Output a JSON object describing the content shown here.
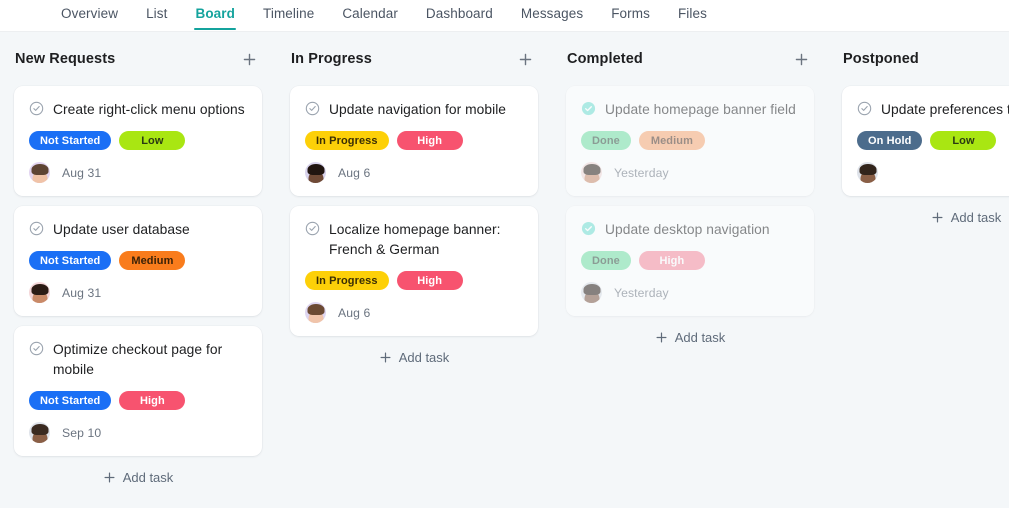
{
  "nav": {
    "tabs": [
      {
        "label": "Overview",
        "active": false
      },
      {
        "label": "List",
        "active": false
      },
      {
        "label": "Board",
        "active": true
      },
      {
        "label": "Timeline",
        "active": false
      },
      {
        "label": "Calendar",
        "active": false
      },
      {
        "label": "Dashboard",
        "active": false
      },
      {
        "label": "Messages",
        "active": false
      },
      {
        "label": "Forms",
        "active": false
      },
      {
        "label": "Files",
        "active": false
      }
    ],
    "active_color": "#14a39d"
  },
  "board": {
    "add_task_label": "Add task",
    "add_column_icon": "plus-icon",
    "columns": [
      {
        "title": "New Requests",
        "show_header_add": true,
        "show_add_task": true,
        "muted": false,
        "cards": [
          {
            "title": "Create right-click menu options",
            "status": {
              "label": "Not Started",
              "bg": "#1a6ff5",
              "fg": "#ffffff"
            },
            "priority": {
              "label": "Low",
              "bg": "#a9e612",
              "fg": "#2b3a12"
            },
            "due": "Aug 31",
            "avatar": {
              "hair": "#5e4433",
              "skin": "#f0c3a8",
              "ring": "#e2d4f0"
            },
            "done": false
          },
          {
            "title": "Update user database",
            "status": {
              "label": "Not Started",
              "bg": "#1a6ff5",
              "fg": "#ffffff"
            },
            "priority": {
              "label": "Medium",
              "bg": "#f97c1c",
              "fg": "#3b2207"
            },
            "due": "Aug 31",
            "avatar": {
              "hair": "#2b1b14",
              "skin": "#c98a68",
              "ring": "#f4d6d8"
            },
            "done": false
          },
          {
            "title": "Optimize checkout page for mobile",
            "status": {
              "label": "Not Started",
              "bg": "#1a6ff5",
              "fg": "#ffffff"
            },
            "priority": {
              "label": "High",
              "bg": "#f7536f",
              "fg": "#ffffff"
            },
            "due": "Sep 10",
            "avatar": {
              "hair": "#3a2a20",
              "skin": "#8a5f46",
              "ring": "#dfe3ea"
            },
            "done": false
          }
        ]
      },
      {
        "title": "In Progress",
        "show_header_add": true,
        "show_add_task": true,
        "muted": false,
        "cards": [
          {
            "title": "Update navigation for mobile",
            "status": {
              "label": "In Progress",
              "bg": "#fdd008",
              "fg": "#3b2f05"
            },
            "priority": {
              "label": "High",
              "bg": "#f7536f",
              "fg": "#ffffff"
            },
            "due": "Aug 6",
            "avatar": {
              "hair": "#201510",
              "skin": "#6f4a36",
              "ring": "#d8d3ec"
            },
            "done": false
          },
          {
            "title": "Localize homepage banner: French & German",
            "status": {
              "label": "In Progress",
              "bg": "#fdd008",
              "fg": "#3b2f05"
            },
            "priority": {
              "label": "High",
              "bg": "#f7536f",
              "fg": "#ffffff"
            },
            "due": "Aug 6",
            "avatar": {
              "hair": "#6b4a33",
              "skin": "#f0c4aa",
              "ring": "#ded6f1"
            },
            "done": false
          }
        ]
      },
      {
        "title": "Completed",
        "show_header_add": true,
        "show_add_task": true,
        "muted": true,
        "cards": [
          {
            "title": "Update homepage banner field",
            "status": {
              "label": "Done",
              "bg": "#6fe0a3",
              "fg": "#2d4a3a"
            },
            "priority": {
              "label": "Medium",
              "bg": "#f8a571",
              "fg": "#4a3020"
            },
            "due": "Yesterday",
            "avatar": {
              "hair": "#241810",
              "skin": "#c98a68",
              "ring": "#f2d8d6"
            },
            "done": true
          },
          {
            "title": "Update desktop navigation",
            "status": {
              "label": "Done",
              "bg": "#6fe0a3",
              "fg": "#2d4a3a"
            },
            "priority": {
              "label": "High",
              "bg": "#f7879b",
              "fg": "#ffffff"
            },
            "due": "Yesterday",
            "avatar": {
              "hair": "#221711",
              "skin": "#7a5340",
              "ring": "#d9dde4"
            },
            "done": true
          }
        ]
      },
      {
        "title": "Postponed",
        "show_header_add": false,
        "show_add_task": true,
        "muted": false,
        "cards": [
          {
            "title": "Update preferences tab",
            "status": {
              "label": "On Hold",
              "bg": "#4c6c8c",
              "fg": "#ffffff"
            },
            "priority": {
              "label": "Low",
              "bg": "#a9e612",
              "fg": "#2b3a12"
            },
            "due": "",
            "avatar": {
              "hair": "#32241b",
              "skin": "#8a5f46",
              "ring": "#dee2e9"
            },
            "done": false
          }
        ]
      }
    ]
  },
  "theme": {
    "page_bg": "#f4f7f9",
    "card_bg": "#ffffff",
    "text_primary": "#1e1f21",
    "text_muted": "#6b7480"
  }
}
